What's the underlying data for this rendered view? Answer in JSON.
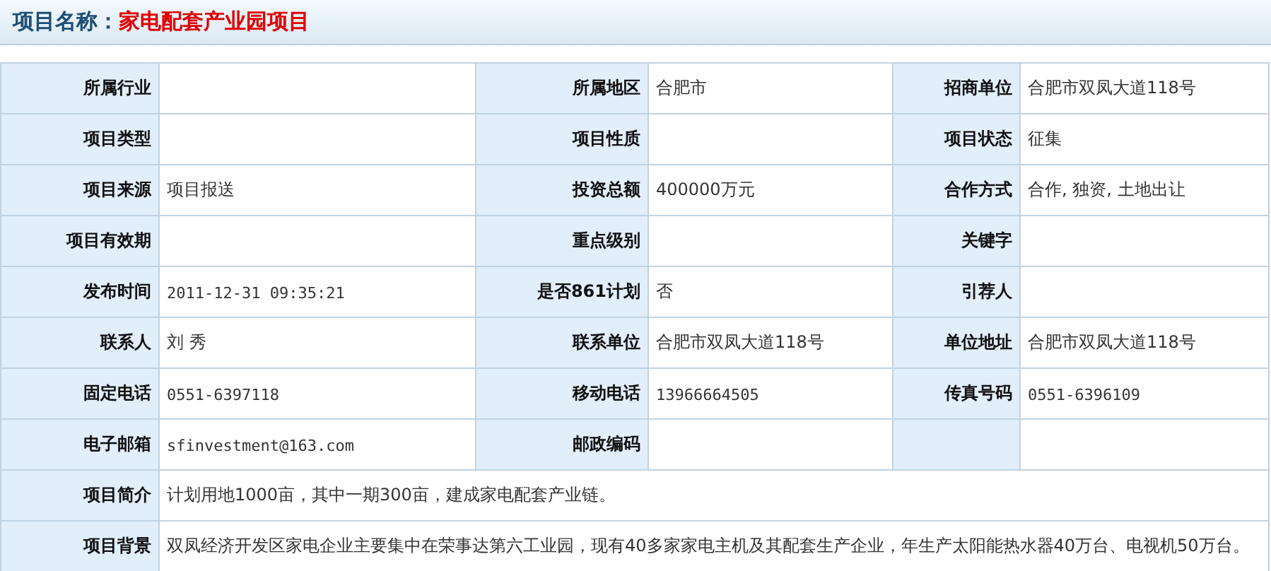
{
  "header": {
    "label": "项目名称：",
    "value": "家电配套产业园项目"
  },
  "rows": [
    {
      "cells": [
        {
          "label": "所属行业"
        },
        {
          "label": "所属地区",
          "value": "合肥市"
        },
        {
          "label": "招商单位",
          "value": "合肥市双凤大道118号"
        }
      ]
    },
    {
      "cells": [
        {
          "label": "项目类型"
        },
        {
          "label": "项目性质"
        },
        {
          "label": "项目状态",
          "value": "征集"
        }
      ]
    },
    {
      "cells": [
        {
          "label": "项目来源",
          "value": "项目报送"
        },
        {
          "label": "投资总额",
          "value": "400000万元"
        },
        {
          "label": "合作方式",
          "value": "合作, 独资, 土地出让"
        }
      ]
    },
    {
      "cells": [
        {
          "label": "项目有效期"
        },
        {
          "label": "重点级别"
        },
        {
          "label": "关键字"
        }
      ]
    },
    {
      "cells": [
        {
          "label": "发布时间",
          "value": "2011-12-31 09:35:21",
          "kind": "mono"
        },
        {
          "label": "是否861计划",
          "value": "否"
        },
        {
          "label": "引荐人"
        }
      ]
    },
    {
      "cells": [
        {
          "label": "联系人",
          "value": "刘 秀"
        },
        {
          "label": "联系单位",
          "value": "合肥市双凤大道118号"
        },
        {
          "label": "单位地址",
          "value": "合肥市双凤大道118号"
        }
      ]
    },
    {
      "cells": [
        {
          "label": "固定电话",
          "value": "0551-6397118",
          "kind": "mono"
        },
        {
          "label": "移动电话",
          "value": "13966664505",
          "kind": "mono"
        },
        {
          "label": "传真号码",
          "value": "0551-6396109",
          "kind": "mono"
        }
      ]
    },
    {
      "cells": [
        {
          "label": "电子邮箱",
          "value": "sfinvestment@163.com",
          "kind": "mono"
        },
        {
          "label": "邮政编码"
        },
        {}
      ]
    },
    {
      "cells": [
        {
          "label": "项目简介",
          "value": "计划用地1000亩，其中一期300亩，建成家电配套产业链。"
        }
      ]
    },
    {
      "cells": [
        {
          "label": "项目背景",
          "value": "双凤经济开发区家电企业主要集中在荣事达第六工业园，现有40多家家电主机及其配套生产企业，年生产太阳能热水器40万台、电视机50万台。"
        }
      ]
    }
  ]
}
